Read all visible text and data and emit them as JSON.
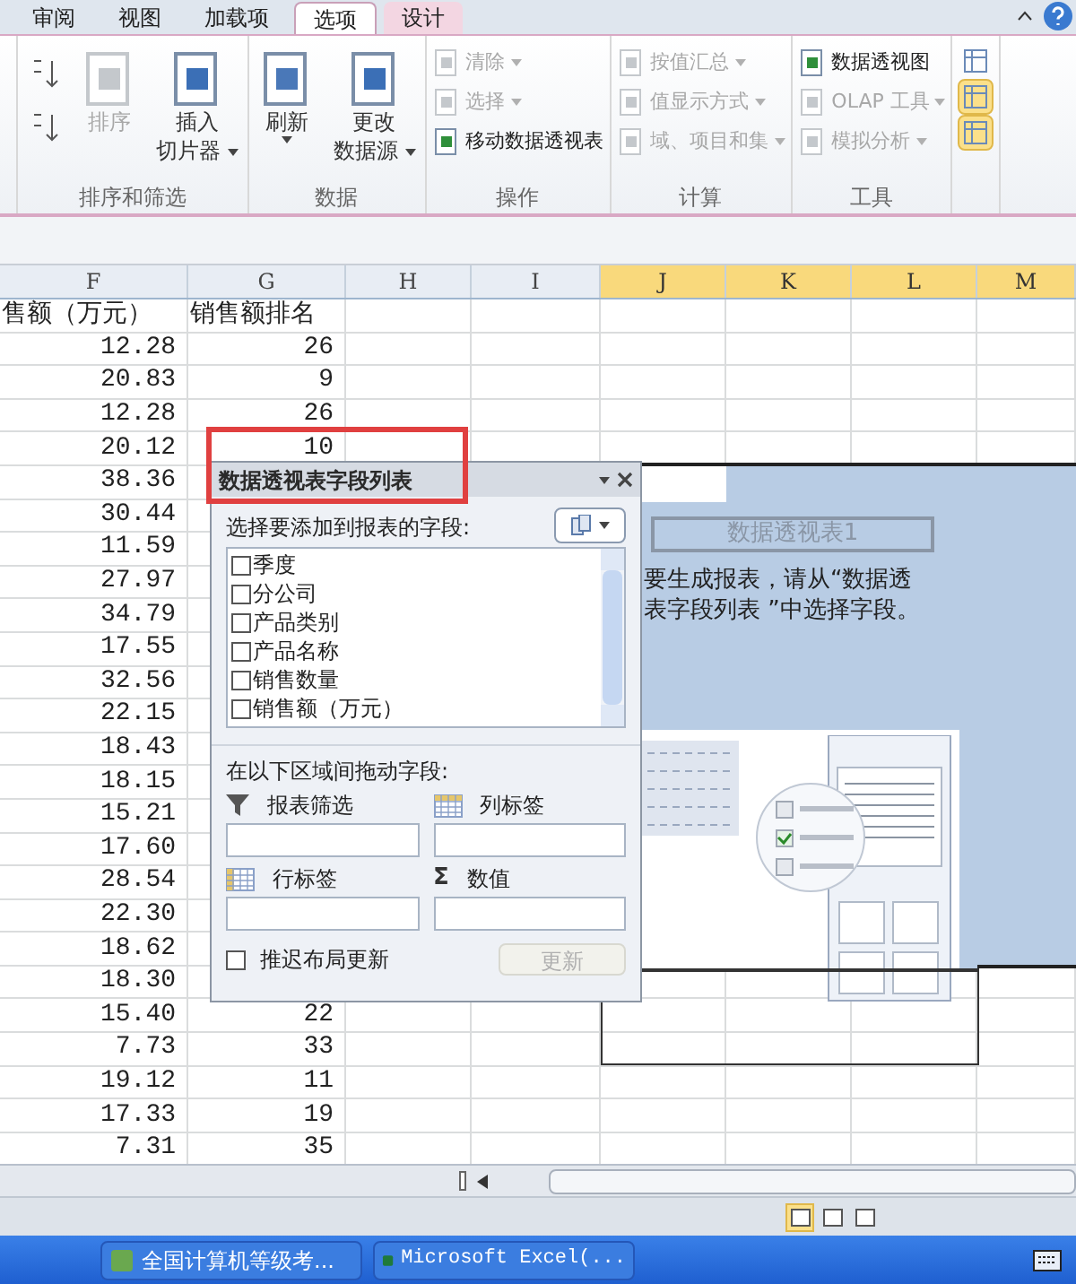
{
  "ribbon_tabs": [
    {
      "label": "审阅",
      "selected": false,
      "contextual": false
    },
    {
      "label": "视图",
      "selected": false,
      "contextual": false
    },
    {
      "label": "加载项",
      "selected": false,
      "contextual": false
    },
    {
      "label": "选项",
      "selected": true,
      "contextual": true
    },
    {
      "label": "设计",
      "selected": false,
      "contextual": true
    }
  ],
  "ribbon_groups": [
    {
      "label": "排序和筛选",
      "items": [
        {
          "kind": "sort_pair"
        },
        {
          "kind": "large",
          "lines": [
            "排序"
          ],
          "disabled": true,
          "dropdown": false
        },
        {
          "kind": "large",
          "lines": [
            "插入",
            "切片器"
          ],
          "disabled": false,
          "dropdown": true
        }
      ]
    },
    {
      "label": "数据",
      "items": [
        {
          "kind": "large",
          "lines": [
            "刷新"
          ],
          "disabled": false,
          "dropdown": true
        },
        {
          "kind": "large",
          "lines": [
            "更改",
            "数据源"
          ],
          "disabled": false,
          "dropdown": true
        }
      ]
    },
    {
      "label": "操作",
      "items": [
        {
          "kind": "small",
          "lines": [
            "清除"
          ],
          "disabled": true,
          "dropdown": true
        },
        {
          "kind": "small",
          "lines": [
            "选择"
          ],
          "disabled": true,
          "dropdown": true
        },
        {
          "kind": "small",
          "lines": [
            "移动数据透视表"
          ],
          "disabled": false,
          "dropdown": false
        }
      ]
    },
    {
      "label": "计算",
      "items": [
        {
          "kind": "small",
          "lines": [
            "按值汇总"
          ],
          "disabled": true,
          "dropdown": true
        },
        {
          "kind": "small",
          "lines": [
            "值显示方式"
          ],
          "disabled": true,
          "dropdown": true
        },
        {
          "kind": "small",
          "lines": [
            "域、项目和集"
          ],
          "disabled": true,
          "dropdown": true
        }
      ]
    },
    {
      "label": "工具",
      "items": [
        {
          "kind": "small",
          "lines": [
            "数据透视图"
          ],
          "disabled": false,
          "dropdown": false
        },
        {
          "kind": "small",
          "lines": [
            "OLAP 工具"
          ],
          "disabled": true,
          "dropdown": true
        },
        {
          "kind": "small",
          "lines": [
            "模拟分析"
          ],
          "disabled": true,
          "dropdown": true
        }
      ]
    },
    {
      "items": [
        {
          "kind": "toggle",
          "on": false
        },
        {
          "kind": "toggle",
          "on": true
        },
        {
          "kind": "toggle",
          "on": true
        }
      ]
    }
  ],
  "columns": [
    {
      "label": "F",
      "selected": false
    },
    {
      "label": "G",
      "selected": false
    },
    {
      "label": "H",
      "selected": false
    },
    {
      "label": "I",
      "selected": false
    },
    {
      "label": "J",
      "selected": true
    },
    {
      "label": "K",
      "selected": true
    },
    {
      "label": "L",
      "selected": true
    },
    {
      "label": "M",
      "selected": true
    }
  ],
  "rows": [
    {
      "f": "售额（万元）",
      "g": "销售额排名"
    },
    {
      "f": "12.28",
      "g": "26"
    },
    {
      "f": "20.83",
      "g": "9"
    },
    {
      "f": "12.28",
      "g": "26"
    },
    {
      "f": "20.12",
      "g": "10"
    },
    {
      "f": "38.36"
    },
    {
      "f": "30.44"
    },
    {
      "f": "11.59"
    },
    {
      "f": "27.97"
    },
    {
      "f": "34.79"
    },
    {
      "f": "17.55"
    },
    {
      "f": "32.56"
    },
    {
      "f": "22.15"
    },
    {
      "f": "18.43"
    },
    {
      "f": "18.15"
    },
    {
      "f": "15.21"
    },
    {
      "f": "17.60"
    },
    {
      "f": "28.54"
    },
    {
      "f": "22.30"
    },
    {
      "f": "18.62"
    },
    {
      "f": "18.30"
    },
    {
      "f": "15.40",
      "g": "22"
    },
    {
      "f": "7.73",
      "g": "33"
    },
    {
      "f": "19.12",
      "g": "11"
    },
    {
      "f": "17.33",
      "g": "19"
    },
    {
      "f": "7.31",
      "g": "35"
    }
  ],
  "pivot_placeholder": {
    "title": "数据透视表1",
    "instruction_lines": [
      "要生成报表，请从“数据透",
      "表字段列表 ”中选择字段。"
    ]
  },
  "field_list": {
    "title": "数据透视表字段列表",
    "choose_label": "选择要添加到报表的字段:",
    "fields": [
      {
        "label": "季度",
        "checked": false
      },
      {
        "label": "分公司",
        "checked": false
      },
      {
        "label": "产品类别",
        "checked": false
      },
      {
        "label": "产品名称",
        "checked": false
      },
      {
        "label": "销售数量",
        "checked": false
      },
      {
        "label": "销售额（万元）",
        "checked": false
      }
    ],
    "drag_label": "在以下区域间拖动字段:",
    "areas": [
      {
        "kind": "filter",
        "label": "报表筛选"
      },
      {
        "kind": "columns",
        "label": "列标签"
      },
      {
        "kind": "rows",
        "label": "行标签"
      },
      {
        "kind": "values",
        "symbol": "Σ",
        "label": "数值"
      }
    ],
    "defer": {
      "label": "推迟布局更新",
      "checked": false
    },
    "update_button": {
      "label": "更新",
      "disabled": true
    }
  },
  "status_bar": {
    "views": [
      {
        "selected": true
      },
      {
        "selected": false
      },
      {
        "selected": false
      }
    ]
  },
  "taskbar": [
    {
      "label": "全国计算机等级考..."
    },
    {
      "label": "Microsoft Excel(..."
    }
  ]
}
